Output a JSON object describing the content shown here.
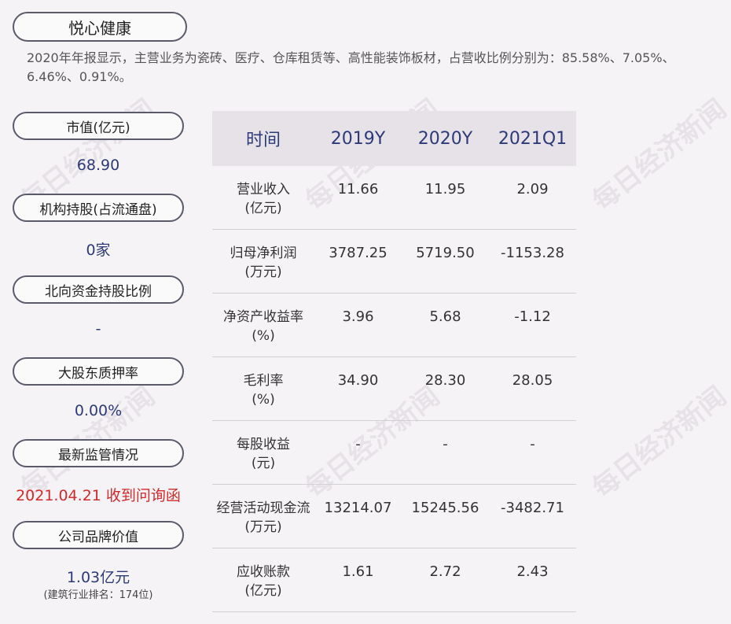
{
  "company": "悦心健康",
  "description": "2020年年报显示，主营业务为瓷砖、医疗、仓库租赁等、高性能装饰板材，占营收比例分别为：85.58%、7.05%、6.46%、0.91%。",
  "watermark": "每日经济新闻",
  "left_panel": [
    {
      "label": "市值(亿元)",
      "value": "68.90"
    },
    {
      "label": "机构持股(占流通盘)",
      "value": "0家"
    },
    {
      "label": "北向资金持股比例",
      "value": "-"
    },
    {
      "label": "大股东质押率",
      "value": "0.00%"
    },
    {
      "label": "最新监管情况",
      "value": "2021.04.21 收到问询函"
    },
    {
      "label": "公司品牌价值",
      "value": "1.03亿元",
      "note": "(建筑行业排名：174位)"
    }
  ],
  "table": {
    "headers": [
      "时间",
      "2019Y",
      "2020Y",
      "2021Q1"
    ],
    "rows": [
      {
        "name": "营业收入",
        "unit": "(亿元)",
        "values": [
          "11.66",
          "11.95",
          "2.09"
        ]
      },
      {
        "name": "归母净利润",
        "unit": "(万元)",
        "values": [
          "3787.25",
          "5719.50",
          "-1153.28"
        ]
      },
      {
        "name": "净资产收益率",
        "unit": "(%)",
        "values": [
          "3.96",
          "5.68",
          "-1.12"
        ]
      },
      {
        "name": "毛利率",
        "unit": "(%)",
        "values": [
          "34.90",
          "28.30",
          "28.05"
        ]
      },
      {
        "name": "每股收益",
        "unit": "(元)",
        "values": [
          "-",
          "-",
          "-"
        ]
      },
      {
        "name": "经营活动现金流",
        "unit": "(万元)",
        "values": [
          "13214.07",
          "15245.56",
          "-3482.71"
        ]
      },
      {
        "name": "应收账款",
        "unit": "(亿元)",
        "values": [
          "1.61",
          "2.72",
          "2.43"
        ]
      }
    ]
  },
  "colors": {
    "accent": "#2c3a78",
    "alert": "#d22a2a",
    "header_bg": "#e6e2e8",
    "page_bg": "#f6f3f6"
  }
}
